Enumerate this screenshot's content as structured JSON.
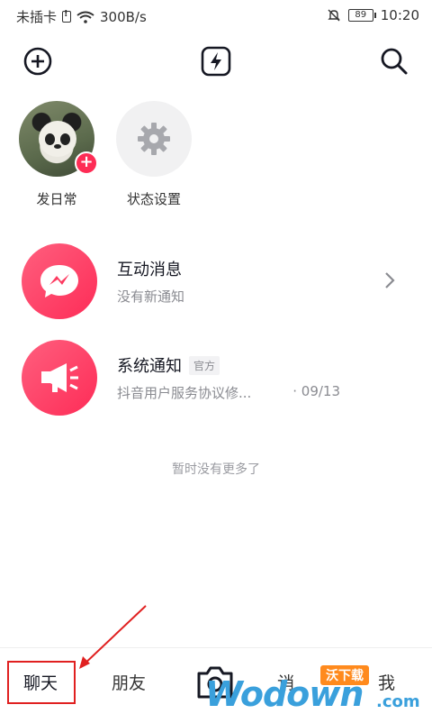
{
  "status_bar": {
    "carrier": "未插卡",
    "net_speed": "300B/s",
    "battery": "89",
    "time": "10:20"
  },
  "stories": [
    {
      "label": "发日常"
    },
    {
      "label": "状态设置"
    }
  ],
  "messages": [
    {
      "title": "互动消息",
      "subtitle": "没有新通知"
    },
    {
      "title": "系统通知",
      "tag": "官方",
      "subtitle": "抖音用户服务协议修...",
      "time": "· 09/13"
    }
  ],
  "empty_note": "暂时没有更多了",
  "tabs": {
    "chat": "聊天",
    "friends": "朋友",
    "partial": "诮",
    "me": "我"
  },
  "watermark": {
    "brand": "Wodown",
    "suffix": ".com",
    "badge": "沃下载"
  },
  "colors": {
    "accent": "#fe2c55",
    "annotation": "#e02020",
    "watermark": "#3aa0dc"
  }
}
